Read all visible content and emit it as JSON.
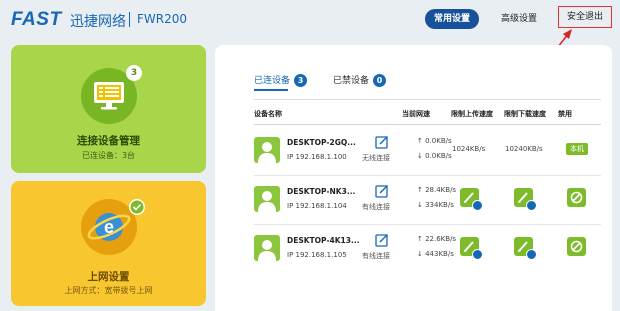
{
  "header": {
    "brand": "FAST",
    "brand_cn": "迅捷网络",
    "model": "FWR200",
    "nav": {
      "common": "常用设置",
      "advanced": "高级设置",
      "logout": "安全退出"
    }
  },
  "cards": {
    "devices": {
      "badge": "3",
      "title": "连接设备管理",
      "subtitle": "已连设备：3台"
    },
    "internet": {
      "title": "上网设置",
      "subtitle": "上网方式：宽带拨号上网"
    }
  },
  "tabs": {
    "connected": {
      "label": "已连设备",
      "count": "3"
    },
    "blocked": {
      "label": "已禁设备",
      "count": "0"
    }
  },
  "table": {
    "headers": {
      "name": "设备名称",
      "speed": "当前网速",
      "limit_up": "限制上传速度",
      "limit_down": "限制下载速度",
      "block": "禁用"
    },
    "rows": [
      {
        "name": "DESKTOP-2GQ...",
        "ip": "IP 192.168.1.100",
        "conn": "无线连接",
        "up": "↑ 0.0KB/s",
        "down": "↓ 0.0KB/s",
        "limit_up": "1024KB/s",
        "limit_down": "10240KB/s",
        "local": "本机"
      },
      {
        "name": "DESKTOP-NK3...",
        "ip": "IP 192.168.1.104",
        "conn": "有线连接",
        "up": "↑ 28.4KB/s",
        "down": "↓ 334KB/s"
      },
      {
        "name": "DESKTOP-4K13...",
        "ip": "IP 192.168.1.105",
        "conn": "有线连接",
        "up": "↑ 22.6KB/s",
        "down": "↓ 443KB/s"
      }
    ]
  },
  "colors": {
    "brand_blue": "#1768b4",
    "green": "#a8d54a",
    "yellow": "#f8c72f",
    "action_green": "#7dbb2b",
    "highlight_red": "#e03232"
  }
}
